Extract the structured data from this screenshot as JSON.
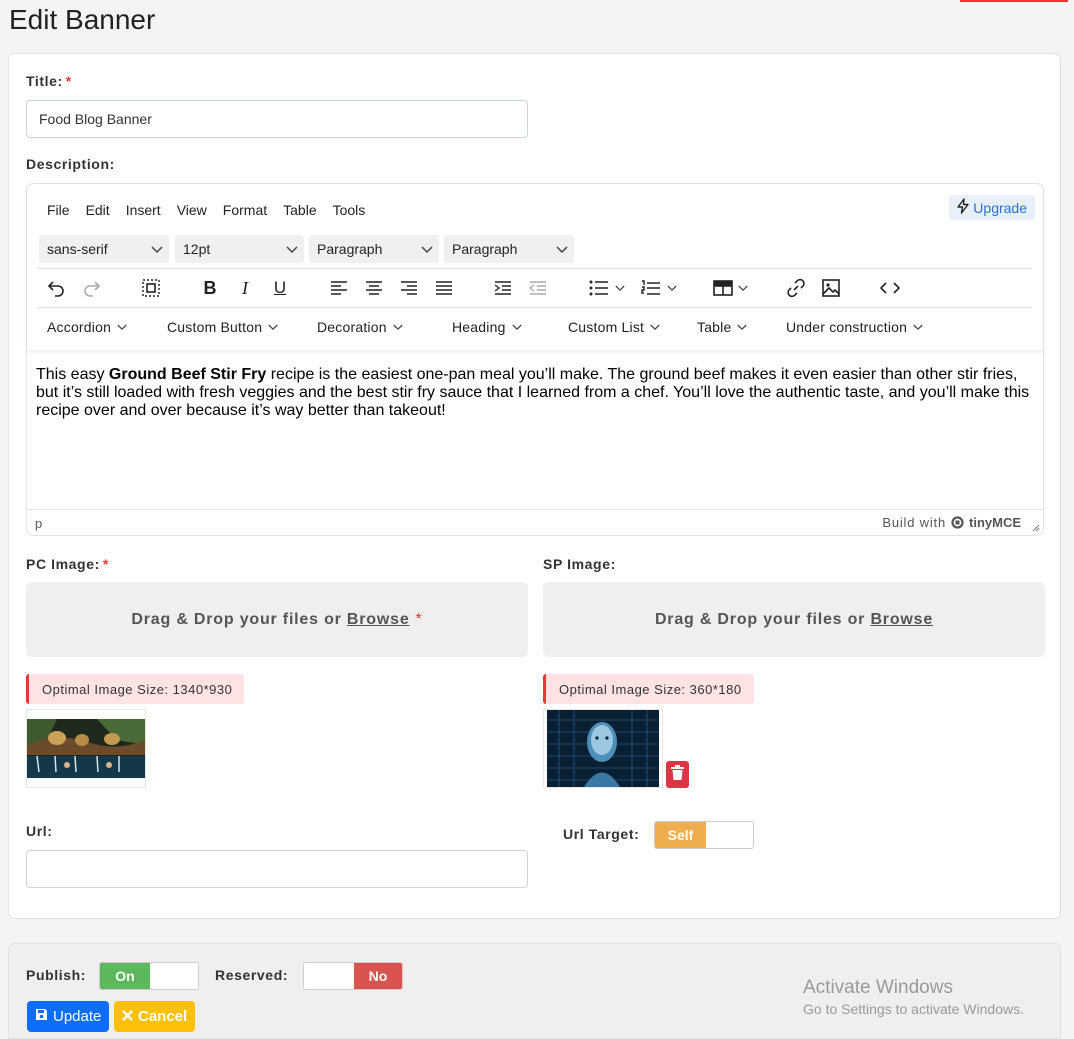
{
  "page": {
    "title": "Edit Banner"
  },
  "form": {
    "title_label": "Title:",
    "required_mark": "*",
    "title_value": "Food Blog Banner",
    "description_label": "Description:",
    "pc_image_label": "PC Image:",
    "sp_image_label": "SP Image:",
    "url_label": "Url:",
    "url_value": "",
    "url_target_label": "Url Target:",
    "url_target_value": "Self"
  },
  "editor": {
    "menu": [
      "File",
      "Edit",
      "Insert",
      "View",
      "Format",
      "Table",
      "Tools"
    ],
    "upgrade_label": "Upgrade",
    "font_family": "sans-serif",
    "font_size": "12pt",
    "block_format_1": "Paragraph",
    "block_format_2": "Paragraph",
    "toolbar_icons": [
      "undo-icon",
      "redo-icon",
      "select-all-icon",
      "bold-icon",
      "italic-icon",
      "underline-icon",
      "align-left-icon",
      "align-center-icon",
      "align-right-icon",
      "align-justify-icon",
      "indent-icon",
      "outdent-icon",
      "bullet-list-icon",
      "numbered-list-icon",
      "table-icon",
      "link-icon",
      "image-icon",
      "code-icon"
    ],
    "menu2": [
      "Accordion",
      "Custom Button",
      "Decoration",
      "Heading",
      "Custom List",
      "Table",
      "Under construction"
    ],
    "content_before": "This easy ",
    "content_bold": "Ground Beef Stir Fry",
    "content_after": " recipe is the easiest one-pan meal you’ll make. The ground beef makes it even easier than other stir fries, but it’s still loaded with fresh veggies and the best stir fry sauce that I learned from a chef. You’ll love the authentic taste, and you’ll make this recipe over and over because it’s way better than takeout!",
    "status_path": "p",
    "branding": "Build with",
    "branding_name": "tinyMCE"
  },
  "pc_upload": {
    "drop_text": "Drag & Drop your files or",
    "browse": "Browse",
    "optimal": "Optimal Image Size: 1340*930"
  },
  "sp_upload": {
    "drop_text": "Drag & Drop your files or",
    "browse": "Browse",
    "optimal": "Optimal Image Size: 360*180"
  },
  "footer": {
    "publish_label": "Publish:",
    "publish_value": "On",
    "reserved_label": "Reserved:",
    "reserved_value": "No",
    "update_label": "Update",
    "cancel_label": "Cancel"
  },
  "watermark": {
    "line1": "Activate Windows",
    "line2": "Go to Settings to activate Windows."
  },
  "colors": {
    "primary": "#0d6efd",
    "warning": "#ffc107",
    "success": "#5cb85c",
    "danger": "#d9534f",
    "self": "#f0ad4e"
  }
}
